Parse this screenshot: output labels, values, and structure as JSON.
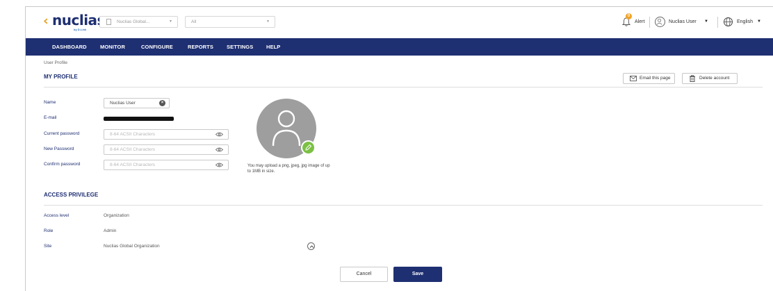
{
  "header": {
    "logo_text": "nuclias",
    "logo_sub": "by D-Link",
    "org_select_value": "Nuclias Global...",
    "site_select_value": "All",
    "alert_count": "0",
    "alert_label": "Alert",
    "user_label": "Nuclias User",
    "language_label": "English"
  },
  "nav": {
    "items": [
      "DASHBOARD",
      "MONITOR",
      "CONFIGURE",
      "REPORTS",
      "SETTINGS",
      "HELP"
    ]
  },
  "breadcrumb": "User Profile",
  "profile": {
    "title": "MY PROFILE",
    "email_page_label": "Email this page",
    "delete_account_label": "Delete account",
    "name_label": "Name",
    "name_value": "Nuclias User",
    "email_label": "E-mail",
    "current_password_label": "Current password",
    "new_password_label": "New Password",
    "confirm_password_label": "Confirm password",
    "password_placeholder": "8-64 ACSII Characters",
    "upload_note": "You may upload a png, jpeg, jpg image of up to 1MB in size."
  },
  "access": {
    "title": "ACCESS PRIVILEGE",
    "access_level_label": "Access level",
    "access_level_value": "Organization",
    "role_label": "Role",
    "role_value": "Admin",
    "site_label": "Site",
    "site_value": "Nuclias Global Organization"
  },
  "actions": {
    "cancel_label": "Cancel",
    "save_label": "Save"
  },
  "colors": {
    "brand_navy": "#1e2f72",
    "logo_accent": "#e3a52a",
    "alert_badge": "#f0a326",
    "edit_badge": "#7bc043"
  }
}
